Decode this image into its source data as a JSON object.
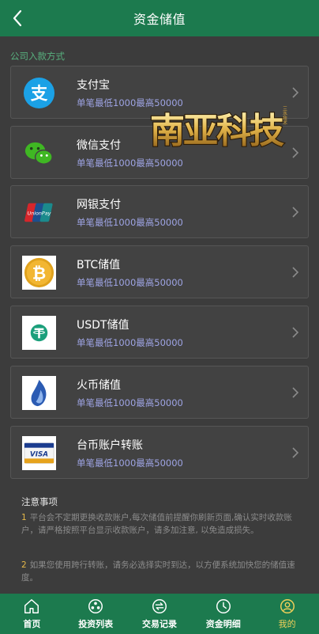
{
  "header": {
    "title": "资金储值",
    "back_icon": "chevron-left-icon"
  },
  "section_label": "公司入款方式",
  "methods": [
    {
      "name": "支付宝",
      "limit": "单笔最低1000最高50000",
      "icon": "alipay-icon"
    },
    {
      "name": "微信支付",
      "limit": "单笔最低1000最高50000",
      "icon": "wechat-pay-icon"
    },
    {
      "name": "网银支付",
      "limit": "单笔最低1000最高50000",
      "icon": "unionpay-icon"
    },
    {
      "name": "BTC储值",
      "limit": "单笔最低1000最高50000",
      "icon": "bitcoin-icon"
    },
    {
      "name": "USDT储值",
      "limit": "单笔最低1000最高50000",
      "icon": "tether-icon"
    },
    {
      "name": "火币储值",
      "limit": "单笔最低1000最高50000",
      "icon": "huobi-icon"
    },
    {
      "name": "台币账户转账",
      "limit": "单笔最低1000最高50000",
      "icon": "visa-card-icon"
    }
  ],
  "watermark": {
    "text": "南亚科技",
    "small_text": "三水技术"
  },
  "notes": {
    "title": "注意事项",
    "items": [
      {
        "num": "1",
        "text": "平台会不定期更换收款账户,每次储值前提醒你刷新页面,确认实时收款账户，请严格按照平台显示收款账户，请多加注意, 以免造成损失。"
      },
      {
        "num": "2",
        "text": "如果您使用跨行转账，请务必选择实时到达，以方便系统加快您的储值速度。"
      }
    ]
  },
  "tabs": [
    {
      "label": "首页",
      "icon": "home-icon",
      "active": false
    },
    {
      "label": "投资列表",
      "icon": "investment-icon",
      "active": false
    },
    {
      "label": "交易记录",
      "icon": "exchange-icon",
      "active": false
    },
    {
      "label": "资金明细",
      "icon": "clock-icon",
      "active": false
    },
    {
      "label": "我的",
      "icon": "user-icon",
      "active": true
    }
  ],
  "colors": {
    "header": "#1c7a4e",
    "background": "#3c3c3c",
    "accent_label": "#58b07e",
    "limit_text": "#9ea4e4",
    "active_tab": "#f0d05a"
  }
}
